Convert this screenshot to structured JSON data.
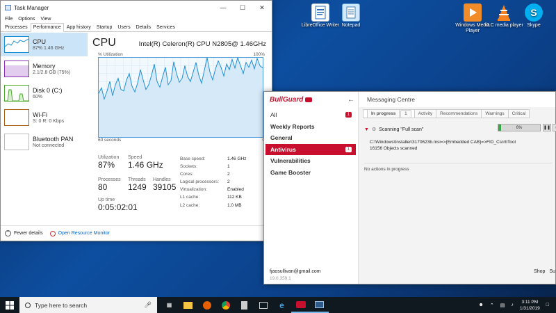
{
  "desktop": {
    "icons": [
      {
        "label": "LibreOffice Writer"
      },
      {
        "label": "Notepad"
      },
      {
        "label": "Windows Media Player"
      },
      {
        "label": "VLC media player"
      },
      {
        "label": "Skype"
      }
    ]
  },
  "task_manager": {
    "title": "Task Manager",
    "menu": [
      "File",
      "Options",
      "View"
    ],
    "tabs": [
      "Processes",
      "Performance",
      "App history",
      "Startup",
      "Users",
      "Details",
      "Services"
    ],
    "active_tab": "Performance",
    "sidebar": [
      {
        "name": "CPU",
        "sub": "87% 1.46 GHz",
        "color": "#1e90d6"
      },
      {
        "name": "Memory",
        "sub": "2.1/2.8 GB (75%)",
        "color": "#8b2fb3"
      },
      {
        "name": "Disk 0 (C:)",
        "sub": "60%",
        "color": "#4ca82c"
      },
      {
        "name": "Wi-Fi",
        "sub": "S: 0 R: 0 Kbps",
        "color": "#a55f15"
      },
      {
        "name": "Bluetooth PAN",
        "sub": "Not connected",
        "color": "#999999"
      }
    ],
    "cpu": {
      "heading": "CPU",
      "model": "Intel(R) Celeron(R) CPU N2805@ 1.46GHz",
      "util_label": "% Utilization",
      "util_max": "100%",
      "time_label": "60 seconds",
      "util_min": "0",
      "utilization_label": "Utilization",
      "utilization": "87%",
      "speed_label": "Speed",
      "speed": "1.46 GHz",
      "processes_label": "Processes",
      "processes": "80",
      "threads_label": "Threads",
      "threads": "1249",
      "handles_label": "Handles",
      "handles": "39105",
      "uptime_label": "Up time",
      "uptime": "0:05:02:01",
      "specs": [
        {
          "k": "Base speed:",
          "v": "1.46 GHz"
        },
        {
          "k": "Sockets:",
          "v": "1"
        },
        {
          "k": "Cores:",
          "v": "2"
        },
        {
          "k": "Logical processors:",
          "v": "2"
        },
        {
          "k": "Virtualization:",
          "v": "Enabled"
        },
        {
          "k": "L1 cache:",
          "v": "112 KB"
        },
        {
          "k": "L2 cache:",
          "v": "1.0 MB"
        }
      ],
      "history": [
        55,
        62,
        48,
        58,
        70,
        52,
        66,
        74,
        60,
        58,
        72,
        80,
        64,
        57,
        68,
        85,
        72,
        60,
        66,
        78,
        92,
        70,
        63,
        76,
        88,
        66,
        71,
        95,
        80,
        69,
        74,
        90,
        76,
        70,
        82,
        94,
        78,
        68,
        84,
        100,
        82,
        72,
        86,
        96,
        88,
        77,
        92,
        85,
        98,
        87,
        100,
        90,
        80,
        94,
        88,
        97,
        86,
        99,
        90,
        87
      ]
    },
    "footer": {
      "fewer": "Fewer details",
      "link": "Open Resource Monitor"
    }
  },
  "bullguard": {
    "logo": "BullGuard",
    "nav": [
      {
        "label": "All",
        "badge": "1"
      },
      {
        "label": "Weekly Reports",
        "badge": ""
      },
      {
        "label": "General",
        "badge": ""
      },
      {
        "label": "Antivirus",
        "badge": "1"
      },
      {
        "label": "Vulnerabilities",
        "badge": ""
      },
      {
        "label": "Game Booster",
        "badge": ""
      }
    ],
    "active_nav": "Antivirus",
    "account": "fjaosullivan@gmail.com",
    "version": "19.0.359.1",
    "panel_title": "Messaging Centre",
    "tabs": [
      {
        "label": "In progress",
        "badge": "1"
      },
      {
        "label": "Activity",
        "badge": ""
      },
      {
        "label": "Recommendations",
        "badge": ""
      },
      {
        "label": "Warnings",
        "badge": ""
      },
      {
        "label": "Critical",
        "badge": ""
      }
    ],
    "scan": {
      "title": "Scanning \"Full scan\"",
      "progress_pct": 6,
      "progress_label": "6%",
      "path": "C:\\Windows\\Installer\\3170623b.msi=>{Embedded CAB}=>FID_CsrrbTool",
      "objects": "16156 Objects scanned"
    },
    "no_actions": "No actions in progress",
    "bottom_links": [
      "Shop",
      "Su"
    ]
  },
  "taskbar": {
    "search_placeholder": "Type here to search",
    "time": "3:11 PM",
    "date": "1/31/2019"
  },
  "colors": {
    "bullguard_red": "#c8102e",
    "cpu_blue": "#1e90d6"
  }
}
